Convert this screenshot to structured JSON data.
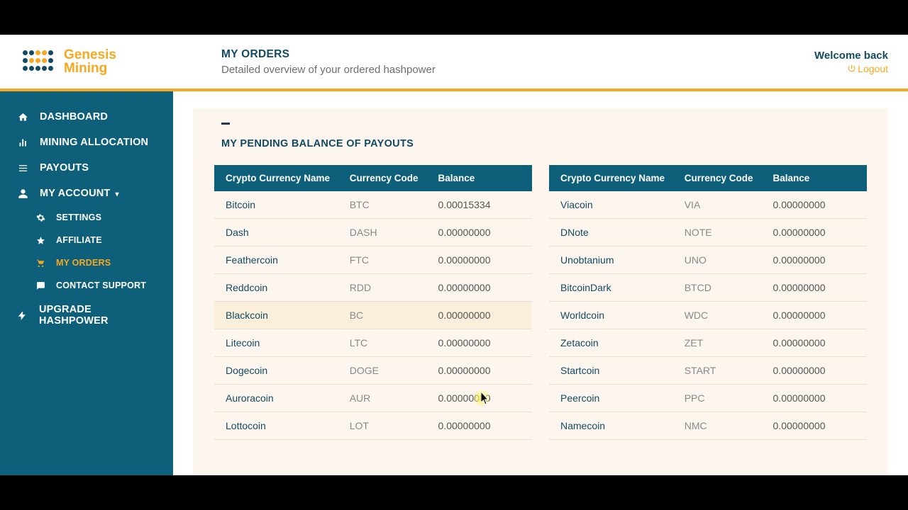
{
  "header": {
    "logo_line1": "Genesis",
    "logo_line2": "Mining",
    "title": "MY ORDERS",
    "subtitle": "Detailed overview of your ordered hashpower",
    "welcome": "Welcome back",
    "logout": "Logout"
  },
  "sidebar": {
    "items": [
      {
        "label": "DASHBOARD"
      },
      {
        "label": "MINING ALLOCATION"
      },
      {
        "label": "PAYOUTS"
      },
      {
        "label": "MY ACCOUNT"
      },
      {
        "label": "UPGRADE HASHPOWER"
      }
    ],
    "sub_items": [
      {
        "label": "SETTINGS"
      },
      {
        "label": "AFFILIATE"
      },
      {
        "label": "MY ORDERS"
      },
      {
        "label": "CONTACT SUPPORT"
      }
    ]
  },
  "panel": {
    "title": "MY PENDING BALANCE OF PAYOUTS"
  },
  "table_headers": {
    "name": "Crypto Currency Name",
    "code": "Currency Code",
    "balance": "Balance"
  },
  "table_left": [
    {
      "name": "Bitcoin",
      "code": "BTC",
      "balance": "0.00015334"
    },
    {
      "name": "Dash",
      "code": "DASH",
      "balance": "0.00000000"
    },
    {
      "name": "Feathercoin",
      "code": "FTC",
      "balance": "0.00000000"
    },
    {
      "name": "Reddcoin",
      "code": "RDD",
      "balance": "0.00000000"
    },
    {
      "name": "Blackcoin",
      "code": "BC",
      "balance": "0.00000000"
    },
    {
      "name": "Litecoin",
      "code": "LTC",
      "balance": "0.00000000"
    },
    {
      "name": "Dogecoin",
      "code": "DOGE",
      "balance": "0.00000000"
    },
    {
      "name": "Auroracoin",
      "code": "AUR",
      "balance": "0.00000000"
    },
    {
      "name": "Lottocoin",
      "code": "LOT",
      "balance": "0.00000000"
    }
  ],
  "table_right": [
    {
      "name": "Viacoin",
      "code": "VIA",
      "balance": "0.00000000"
    },
    {
      "name": "DNote",
      "code": "NOTE",
      "balance": "0.00000000"
    },
    {
      "name": "Unobtanium",
      "code": "UNO",
      "balance": "0.00000000"
    },
    {
      "name": "BitcoinDark",
      "code": "BTCD",
      "balance": "0.00000000"
    },
    {
      "name": "Worldcoin",
      "code": "WDC",
      "balance": "0.00000000"
    },
    {
      "name": "Zetacoin",
      "code": "ZET",
      "balance": "0.00000000"
    },
    {
      "name": "Startcoin",
      "code": "START",
      "balance": "0.00000000"
    },
    {
      "name": "Peercoin",
      "code": "PPC",
      "balance": "0.00000000"
    },
    {
      "name": "Namecoin",
      "code": "NMC",
      "balance": "0.00000000"
    }
  ],
  "hover_row_index": 4
}
